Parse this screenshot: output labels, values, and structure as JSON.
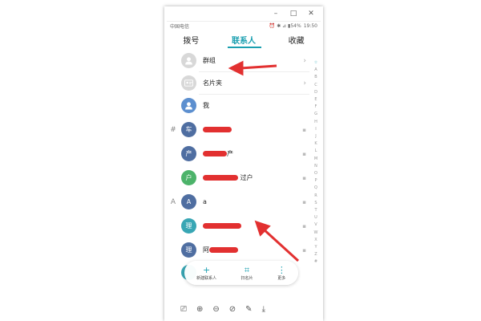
{
  "window": {
    "minimize": "–",
    "maximize": "□",
    "close": "✕"
  },
  "status": {
    "carrier": "中国电信",
    "indicators": "⏰ ✱ ⊿ ▮54%",
    "time": "19:50"
  },
  "tabs": [
    {
      "label": "拨号"
    },
    {
      "label": "联系人"
    },
    {
      "label": "收藏"
    }
  ],
  "rows": [
    {
      "section": "",
      "avatar": "",
      "name": "群组"
    },
    {
      "section": "",
      "avatar": "",
      "name": "名片夹"
    },
    {
      "section": "",
      "avatar": "",
      "name": "我"
    },
    {
      "section": "#",
      "avatar": "车",
      "name": ""
    },
    {
      "section": "",
      "avatar": "产",
      "name": "产"
    },
    {
      "section": "",
      "avatar": "户",
      "name": "过户"
    },
    {
      "section": "A",
      "avatar": "A",
      "name": "a"
    },
    {
      "section": "",
      "avatar": "理",
      "name": ""
    },
    {
      "section": "",
      "avatar": "理",
      "name": "阿"
    }
  ],
  "index_letters": [
    "☆",
    "A",
    "B",
    "C",
    "D",
    "E",
    "F",
    "G",
    "H",
    "I",
    "J",
    "K",
    "L",
    "M",
    "N",
    "O",
    "P",
    "Q",
    "R",
    "S",
    "T",
    "U",
    "V",
    "W",
    "X",
    "Y",
    "Z",
    "#"
  ],
  "bottombar": [
    {
      "icon": "+",
      "label": "新建联系人"
    },
    {
      "icon": "⌗",
      "label": "扫名片"
    },
    {
      "icon": "⋮",
      "label": "更多"
    }
  ],
  "toolbar": [
    "⎚",
    "⊕",
    "⊖",
    "⊘",
    "✎",
    "⤓"
  ],
  "colors": {
    "accent": "#1a9fb0",
    "annotation": "#e23030"
  }
}
